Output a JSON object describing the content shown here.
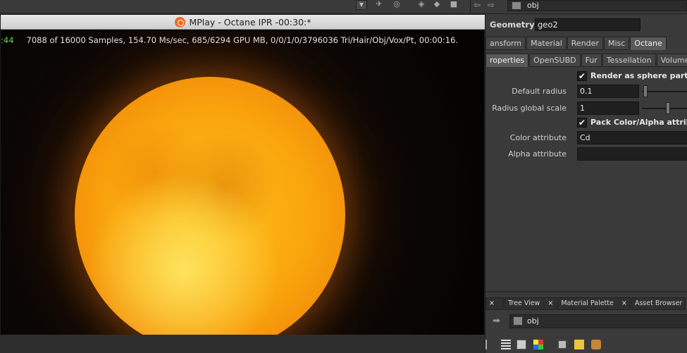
{
  "mplay": {
    "title": "MPlay - Octane IPR -00:30:*",
    "stats_time": ":44",
    "stats_text": "7088 of 16000 Samples, 154.70 Ms/sec, 685/6294 GPU MB, 0/0/1/0/3796036 Tri/Hair/Obj/Vox/Pt, 00:00:16."
  },
  "top": {
    "path": "obj",
    "nav_back": "⇦",
    "nav_fwd": "⇨"
  },
  "geometry": {
    "label": "Geometry",
    "name": "geo2"
  },
  "tabs_primary": [
    "ansform",
    "Material",
    "Render",
    "Misc",
    "Octane"
  ],
  "tabs_secondary": [
    "roperties",
    "OpenSUBD",
    "Fur",
    "Tessellation",
    "Volumes"
  ],
  "params": {
    "render_as_sphere": "Render as sphere particles",
    "default_radius_label": "Default radius",
    "default_radius_value": "0.1",
    "radius_global_scale_label": "Radius global scale",
    "radius_global_scale_value": "1",
    "pack_color_alpha": "Pack Color/Alpha attributes",
    "color_attribute_label": "Color attribute",
    "color_attribute_value": "Cd",
    "alpha_attribute_label": "Alpha attribute",
    "alpha_attribute_value": ""
  },
  "panes": {
    "tabs": [
      "Tree View",
      "Material Palette",
      "Asset Browser"
    ],
    "path": "obj"
  },
  "colors": {
    "accent_green": "#66d05a",
    "sun_core": "#ffc21a",
    "sun_edge": "#d8650a"
  }
}
